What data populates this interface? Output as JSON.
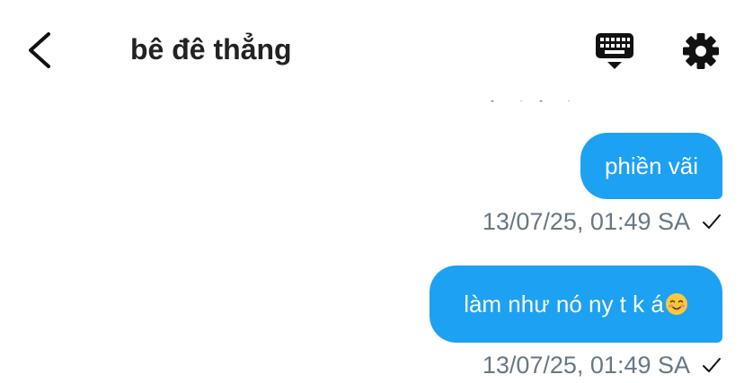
{
  "header": {
    "title": "bê đê thẳng",
    "back_icon": "chevron-left-icon",
    "keyboard_icon": "keyboard-hide-icon",
    "settings_icon": "gear-icon"
  },
  "messages": [
    {
      "text": "phiền vãi",
      "emoji": "",
      "timestamp": "13/07/25, 01:49 SA",
      "status_icon": "checkmark-icon",
      "direction": "outgoing"
    },
    {
      "text": "làm như nó ny t k á",
      "emoji": "☺️",
      "timestamp": "13/07/25, 01:49 SA",
      "status_icon": "checkmark-icon",
      "direction": "outgoing"
    }
  ],
  "colors": {
    "accent": "#1da1f2",
    "title": "#222222",
    "timestamp": "#697784",
    "icon": "#111111",
    "background": "#ffffff"
  }
}
